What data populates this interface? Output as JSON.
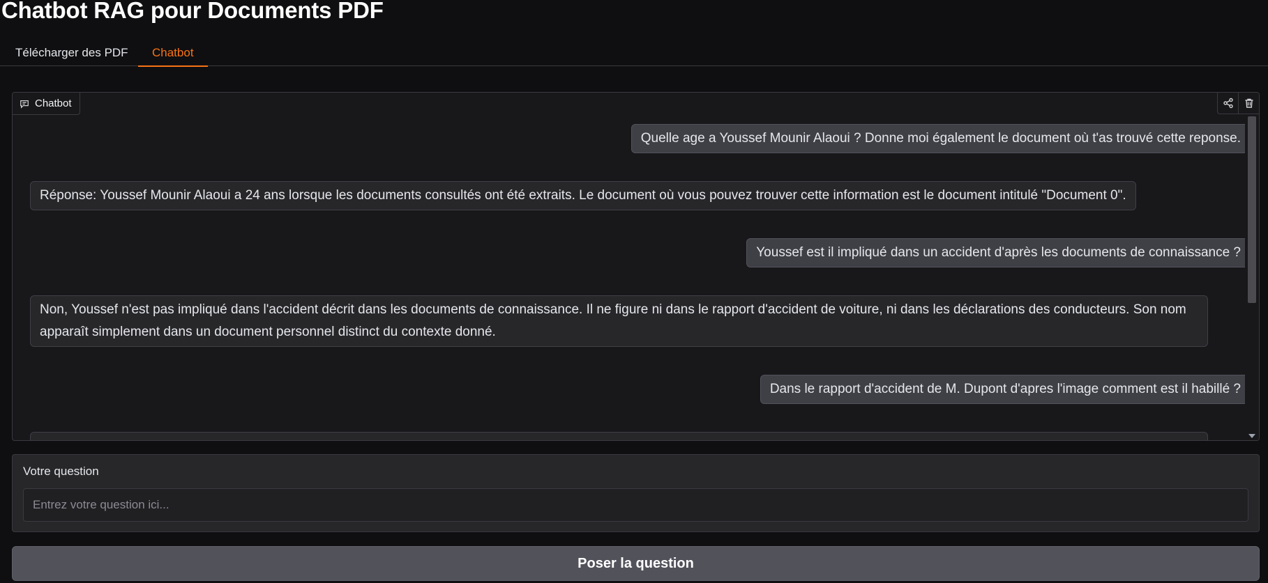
{
  "app": {
    "title": "Chatbot RAG pour Documents PDF"
  },
  "tabs": [
    {
      "label": "Télécharger des PDF",
      "active": false
    },
    {
      "label": "Chatbot",
      "active": true
    }
  ],
  "chatbot": {
    "label": "Chatbot",
    "icons": {
      "label": "chat-bubble-icon",
      "share": "share-icon",
      "clear": "trash-icon"
    },
    "messages": [
      {
        "role": "user",
        "text": "Quelle age a Youssef Mounir Alaoui ? Donne moi également le document où t'as trouvé cette reponse."
      },
      {
        "role": "bot",
        "text": "Réponse: Youssef Mounir Alaoui a 24 ans lorsque les documents consultés ont été extraits. Le document où vous pouvez trouver cette information est le document intitulé \"Document 0\"."
      },
      {
        "role": "user",
        "text": "Youssef est il impliqué dans un accident d'après les documents de connaissance ?"
      },
      {
        "role": "bot",
        "text": "Non, Youssef n'est pas impliqué dans l'accident décrit dans les documents de connaissance. Il ne figure ni dans le rapport d'accident de voiture, ni dans les déclarations des conducteurs. Son nom apparaît simplement dans un document personnel distinct du contexte donné."
      },
      {
        "role": "user",
        "text": "Dans le rapport d'accident de M. Dupont d'apres l'image comment est il habillé ?"
      },
      {
        "role": "bot",
        "text": ""
      }
    ]
  },
  "question": {
    "label": "Votre question",
    "placeholder": "Entrez votre question ici...",
    "value": ""
  },
  "submit": {
    "label": "Poser la question"
  },
  "colors": {
    "accent": "#f97316",
    "background": "#0f0f11",
    "panel": "#18181b",
    "button": "#52525b"
  }
}
